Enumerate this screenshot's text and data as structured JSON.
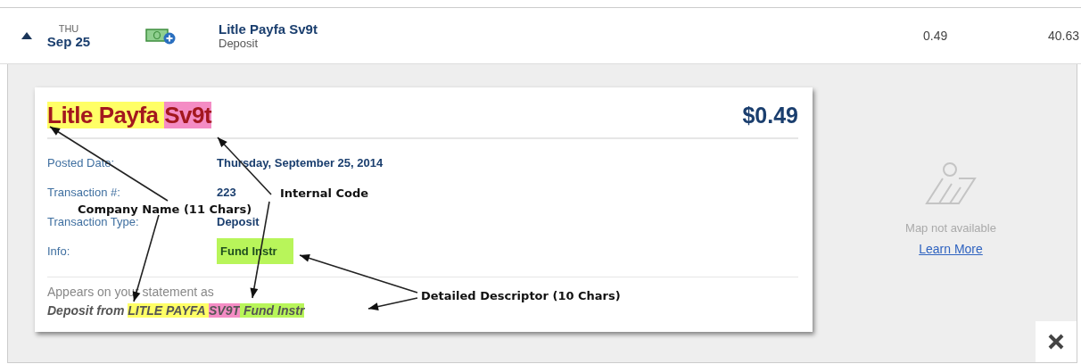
{
  "transaction": {
    "expanded": true,
    "weekday": "THU",
    "date": "Sep 25",
    "name": "Litle Payfa Sv9t",
    "type": "Deposit",
    "amount": "0.49",
    "balance": "40.63"
  },
  "detail": {
    "title_parts": [
      {
        "text": "Litle Payfa ",
        "color": "#ffff66"
      },
      {
        "text": "Sv9t",
        "color": "#f48cc4"
      }
    ],
    "amount": "$0.49",
    "fields": [
      {
        "label": "Posted Date:",
        "value": "Thursday, September 25, 2014"
      },
      {
        "label": "Transaction #:",
        "value": "223"
      },
      {
        "label": "Transaction Type:",
        "value": "Deposit"
      },
      {
        "label": "Info:",
        "value": "Fund Instr",
        "color": "#b8f55a"
      }
    ],
    "statement_label": "Appears on your statement as",
    "statement_parts": [
      {
        "text": "Deposit from "
      },
      {
        "text": "LITLE PAYFA ",
        "color": "#ffff66"
      },
      {
        "text": "SV9T",
        "color": "#f48cc4"
      },
      {
        "text": " Fund Instr",
        "color": "#b8f55a"
      }
    ]
  },
  "map": {
    "message": "Map not available",
    "link": "Learn More"
  },
  "annotations": [
    {
      "text": "Internal Code"
    },
    {
      "text": "Company Name (11 Chars)"
    },
    {
      "text": "Detailed Descriptor (10 Chars)"
    }
  ]
}
